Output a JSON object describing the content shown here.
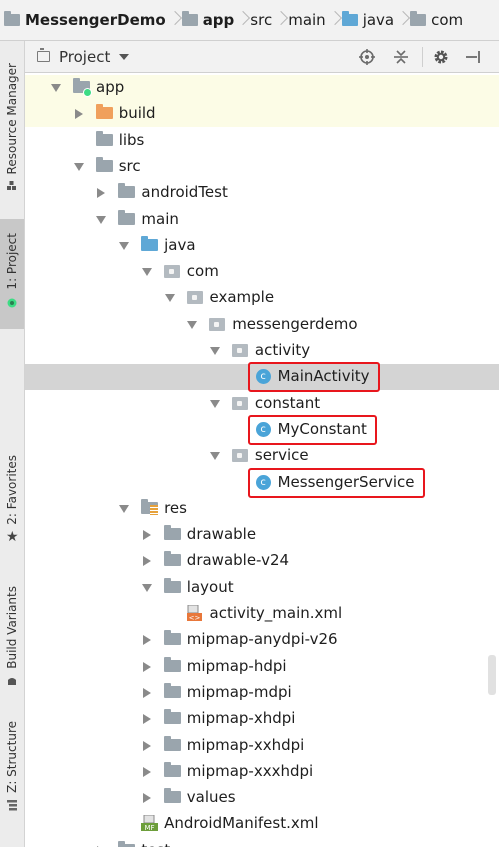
{
  "breadcrumb": [
    {
      "label": "MessengerDemo",
      "icon": "module-icon",
      "bold": true
    },
    {
      "label": "app",
      "icon": "module-folder-icon",
      "bold": true
    },
    {
      "label": "src",
      "icon": "",
      "bold": false
    },
    {
      "label": "main",
      "icon": "",
      "bold": false
    },
    {
      "label": "java",
      "icon": "java-folder-icon",
      "bold": false
    },
    {
      "label": "com",
      "icon": "package-icon",
      "bold": false
    }
  ],
  "side_tabs": {
    "resource_manager": "Resource Manager",
    "project": "1: Project",
    "favorites": "2: Favorites",
    "build_variants": "Build Variants",
    "structure": "Z: Structure"
  },
  "project_panel": {
    "title": "Project",
    "view_dropdown_caret": "chevron-down-icon",
    "tools": [
      "locate-icon",
      "collapse-icon",
      "gear-icon",
      "hide-icon"
    ]
  },
  "tree": [
    {
      "label": "app",
      "icon": "module",
      "expanded": true,
      "level": 0,
      "highlight": true
    },
    {
      "label": "build",
      "icon": "folder-orange",
      "expanded": false,
      "level": 1,
      "highlight": true
    },
    {
      "label": "libs",
      "icon": "folder-grey",
      "expanded": null,
      "level": 1
    },
    {
      "label": "src",
      "icon": "folder-grey",
      "expanded": true,
      "level": 1
    },
    {
      "label": "androidTest",
      "icon": "folder-grey",
      "expanded": false,
      "level": 2
    },
    {
      "label": "main",
      "icon": "folder-grey",
      "expanded": true,
      "level": 2
    },
    {
      "label": "java",
      "icon": "folder-blue",
      "expanded": true,
      "level": 3
    },
    {
      "label": "com",
      "icon": "package",
      "expanded": true,
      "level": 4
    },
    {
      "label": "example",
      "icon": "package",
      "expanded": true,
      "level": 5
    },
    {
      "label": "messengerdemo",
      "icon": "package",
      "expanded": true,
      "level": 6
    },
    {
      "label": "activity",
      "icon": "package",
      "expanded": true,
      "level": 7
    },
    {
      "label": "MainActivity",
      "icon": "class",
      "expanded": null,
      "level": 8,
      "selected": true,
      "boxed": true
    },
    {
      "label": "constant",
      "icon": "package",
      "expanded": true,
      "level": 7
    },
    {
      "label": "MyConstant",
      "icon": "class",
      "expanded": null,
      "level": 8,
      "boxed": true
    },
    {
      "label": "service",
      "icon": "package",
      "expanded": true,
      "level": 7
    },
    {
      "label": "MessengerService",
      "icon": "class",
      "expanded": null,
      "level": 8,
      "boxed": true
    },
    {
      "label": "res",
      "icon": "folder-res",
      "expanded": true,
      "level": 3
    },
    {
      "label": "drawable",
      "icon": "folder-grey",
      "expanded": false,
      "level": 4
    },
    {
      "label": "drawable-v24",
      "icon": "folder-grey",
      "expanded": false,
      "level": 4
    },
    {
      "label": "layout",
      "icon": "folder-grey",
      "expanded": true,
      "level": 4
    },
    {
      "label": "activity_main.xml",
      "icon": "xml",
      "expanded": null,
      "level": 5
    },
    {
      "label": "mipmap-anydpi-v26",
      "icon": "folder-grey",
      "expanded": false,
      "level": 4
    },
    {
      "label": "mipmap-hdpi",
      "icon": "folder-grey",
      "expanded": false,
      "level": 4
    },
    {
      "label": "mipmap-mdpi",
      "icon": "folder-grey",
      "expanded": false,
      "level": 4
    },
    {
      "label": "mipmap-xhdpi",
      "icon": "folder-grey",
      "expanded": false,
      "level": 4
    },
    {
      "label": "mipmap-xxhdpi",
      "icon": "folder-grey",
      "expanded": false,
      "level": 4
    },
    {
      "label": "mipmap-xxxhdpi",
      "icon": "folder-grey",
      "expanded": false,
      "level": 4
    },
    {
      "label": "values",
      "icon": "folder-grey",
      "expanded": false,
      "level": 4
    },
    {
      "label": "AndroidManifest.xml",
      "icon": "manifest",
      "expanded": null,
      "level": 3
    },
    {
      "label": "test",
      "icon": "folder-grey",
      "expanded": false,
      "level": 2
    }
  ],
  "colors": {
    "highlight_box": "#e8161d",
    "selection": "#d4d4d4",
    "java_folder": "#5fa8d6",
    "class_icon": "#4aa4d8",
    "build_folder": "#f0a05c"
  }
}
